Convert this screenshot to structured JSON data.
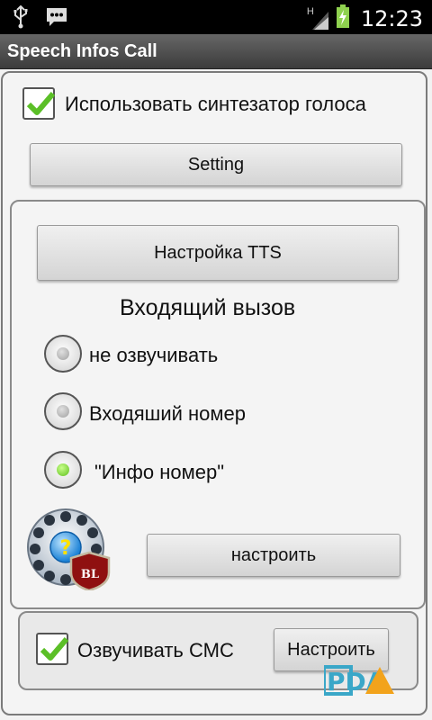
{
  "status_bar": {
    "time": "12:23",
    "signal_label": "H",
    "left_icons": [
      "usb-icon",
      "sms-notification-icon"
    ],
    "right_icons": [
      "signal-icon",
      "battery-charging-icon"
    ]
  },
  "app": {
    "title": "Speech Infos Call"
  },
  "tts_toggle": {
    "label": "Использовать синтезатор голоса",
    "checked": true
  },
  "setting_button": {
    "label": "Setting"
  },
  "tts_settings_button": {
    "label": "Настройка TTS"
  },
  "incoming_call": {
    "heading": "Входящий вызов",
    "options": [
      {
        "label": "не озвучивать",
        "checked": false
      },
      {
        "label": "Входяший номер",
        "checked": false
      },
      {
        "label": "\"Инфо номер\"",
        "checked": true
      }
    ]
  },
  "blacklist": {
    "icon": "blacklist-dialer-icon",
    "badge_text": "BL",
    "button_label": "настроить"
  },
  "sms": {
    "label": "Озвучивать СМС",
    "checked": true,
    "button_label": "Настроить"
  },
  "watermark": {
    "logo_text": "PDA"
  },
  "colors": {
    "title_bar": "#4a4a4a",
    "check_green": "#5bbf27",
    "panel_border": "#8a8a8a"
  }
}
